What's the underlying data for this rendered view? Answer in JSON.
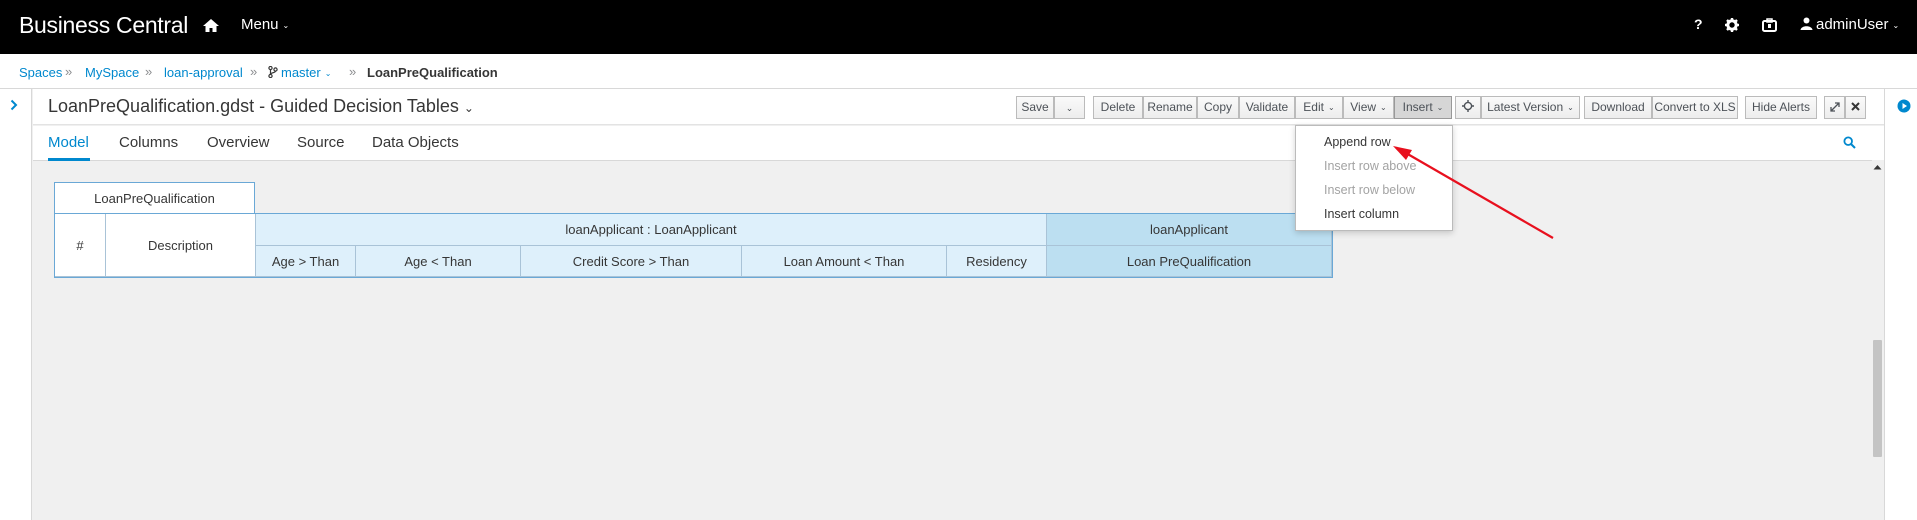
{
  "topbar": {
    "brand": "Business Central",
    "menu_label": "Menu",
    "help_label": "?",
    "user_label": "adminUser"
  },
  "breadcrumb": {
    "items": [
      "Spaces",
      "MySpace",
      "loan-approval",
      "master"
    ],
    "current": "LoanPreQualification",
    "separator": "»"
  },
  "editor": {
    "title": "LoanPreQualification.gdst - Guided Decision Tables",
    "toolbar": {
      "save": "Save",
      "delete": "Delete",
      "rename": "Rename",
      "copy": "Copy",
      "validate": "Validate",
      "edit": "Edit",
      "view": "View",
      "insert": "Insert",
      "latest_version": "Latest Version",
      "download": "Download",
      "convert": "Convert to XLS",
      "hide_alerts": "Hide Alerts"
    },
    "tabs": [
      "Model",
      "Columns",
      "Overview",
      "Source",
      "Data Objects"
    ],
    "active_tab": "Model"
  },
  "insert_menu": {
    "items": [
      {
        "label": "Append row",
        "enabled": true
      },
      {
        "label": "Insert row above",
        "enabled": false
      },
      {
        "label": "Insert row below",
        "enabled": false
      },
      {
        "label": "Insert column",
        "enabled": true
      }
    ]
  },
  "decision_table": {
    "name_tab": "LoanPreQualification",
    "row_number_header": "#",
    "description_header": "Description",
    "condition_group": "loanApplicant : LoanApplicant",
    "conditions": [
      "Age > Than",
      "Age < Than",
      "Credit Score > Than",
      "Loan Amount < Than",
      "Residency"
    ],
    "action_group": "loanApplicant",
    "actions": [
      "Loan PreQualification"
    ]
  },
  "colors": {
    "accent": "#0088ce",
    "condition_header_bg": "#def0fb",
    "action_header_bg": "#bcdff1",
    "annotation_arrow": "#e8101e"
  }
}
